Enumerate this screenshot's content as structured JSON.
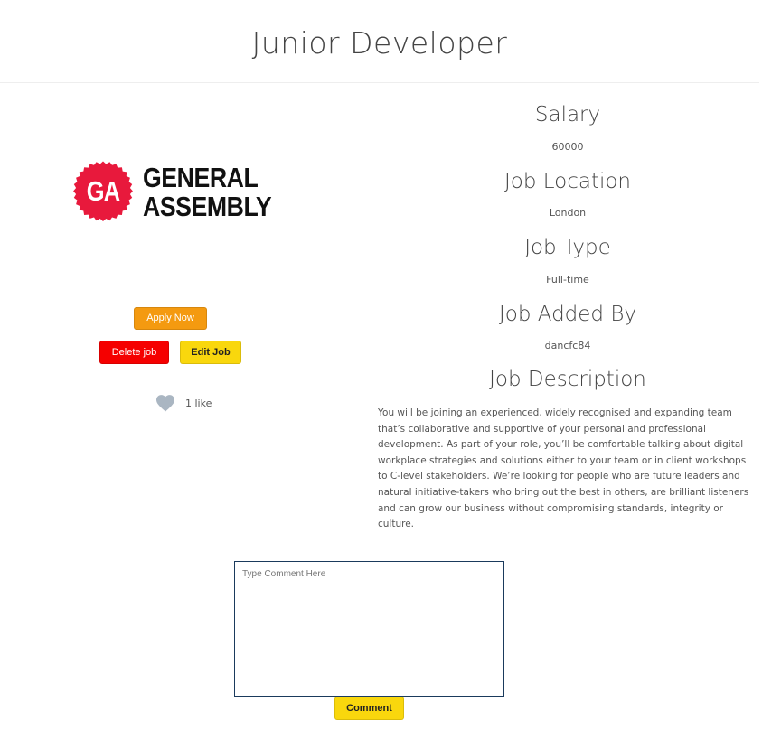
{
  "page": {
    "title": "Junior Developer"
  },
  "company": {
    "logo_mark": "GA",
    "logo_line1": "GENERAL",
    "logo_line2": "ASSEMBLY",
    "logo_color": "#e8193c"
  },
  "actions": {
    "apply_label": "Apply Now",
    "delete_label": "Delete job",
    "edit_label": "Edit Job"
  },
  "likes": {
    "text": "1 like",
    "icon": "heart-icon",
    "icon_color": "#aab6c2"
  },
  "details": {
    "salary_heading": "Salary",
    "salary_value": "60000",
    "location_heading": "Job Location",
    "location_value": "London",
    "type_heading": "Job Type",
    "type_value": "Full-time",
    "added_by_heading": "Job Added By",
    "added_by_value": "dancfc84",
    "description_heading": "Job Description",
    "description_text": "You will be joining an experienced, widely recognised and expanding team that’s collaborative and supportive of your personal and professional development. As part of your role, you’ll be comfortable talking about digital workplace strategies and solutions either to your team or in client workshops to C-level stakeholders. We’re looking for people who are future leaders and natural initiative-takers who bring out the best in others, are brilliant listeners and can grow our business without compromising standards, integrity or culture."
  },
  "comment": {
    "placeholder": "Type Comment Here",
    "button_label": "Comment"
  },
  "colors": {
    "apply": "#f49a10",
    "delete": "#f50000",
    "edit": "#f9d70d"
  }
}
